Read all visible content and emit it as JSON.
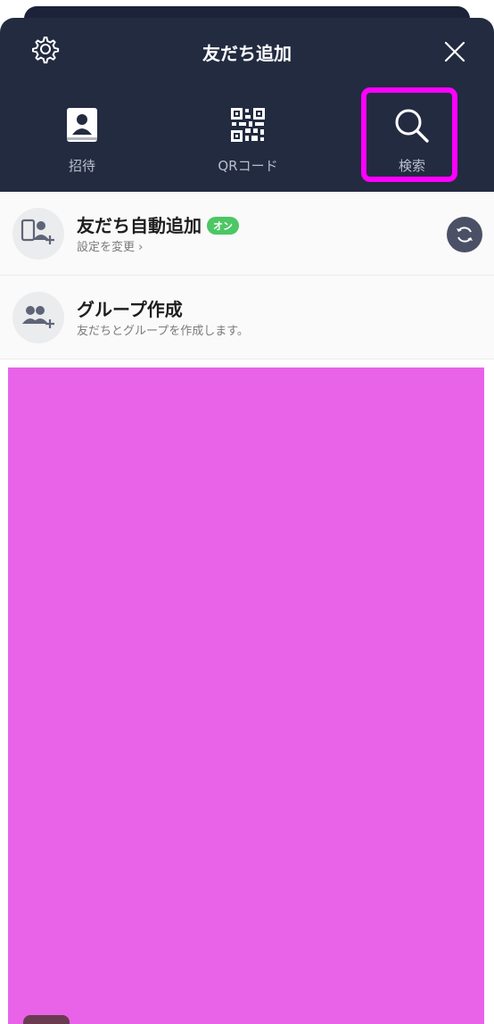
{
  "header": {
    "title": "友だち追加",
    "tabs": [
      {
        "label": "招待",
        "icon": "contacts-book-icon"
      },
      {
        "label": "QRコード",
        "icon": "qr-code-icon"
      },
      {
        "label": "検索",
        "icon": "search-icon"
      }
    ],
    "settings_icon": "gear-icon",
    "close_icon": "close-icon"
  },
  "rows": {
    "auto_add": {
      "title": "友だち自動追加",
      "badge": "オン",
      "sub": "設定を変更 ›",
      "icon": "phone-person-add-icon",
      "action_icon": "sync-icon"
    },
    "group": {
      "title": "グループ作成",
      "sub": "友だちとグループを作成します。",
      "icon": "group-add-icon"
    }
  },
  "colors": {
    "header_bg": "#232b41",
    "highlight": "#ff00ff",
    "badge": "#4cc764",
    "redaction": "#e963e9"
  }
}
